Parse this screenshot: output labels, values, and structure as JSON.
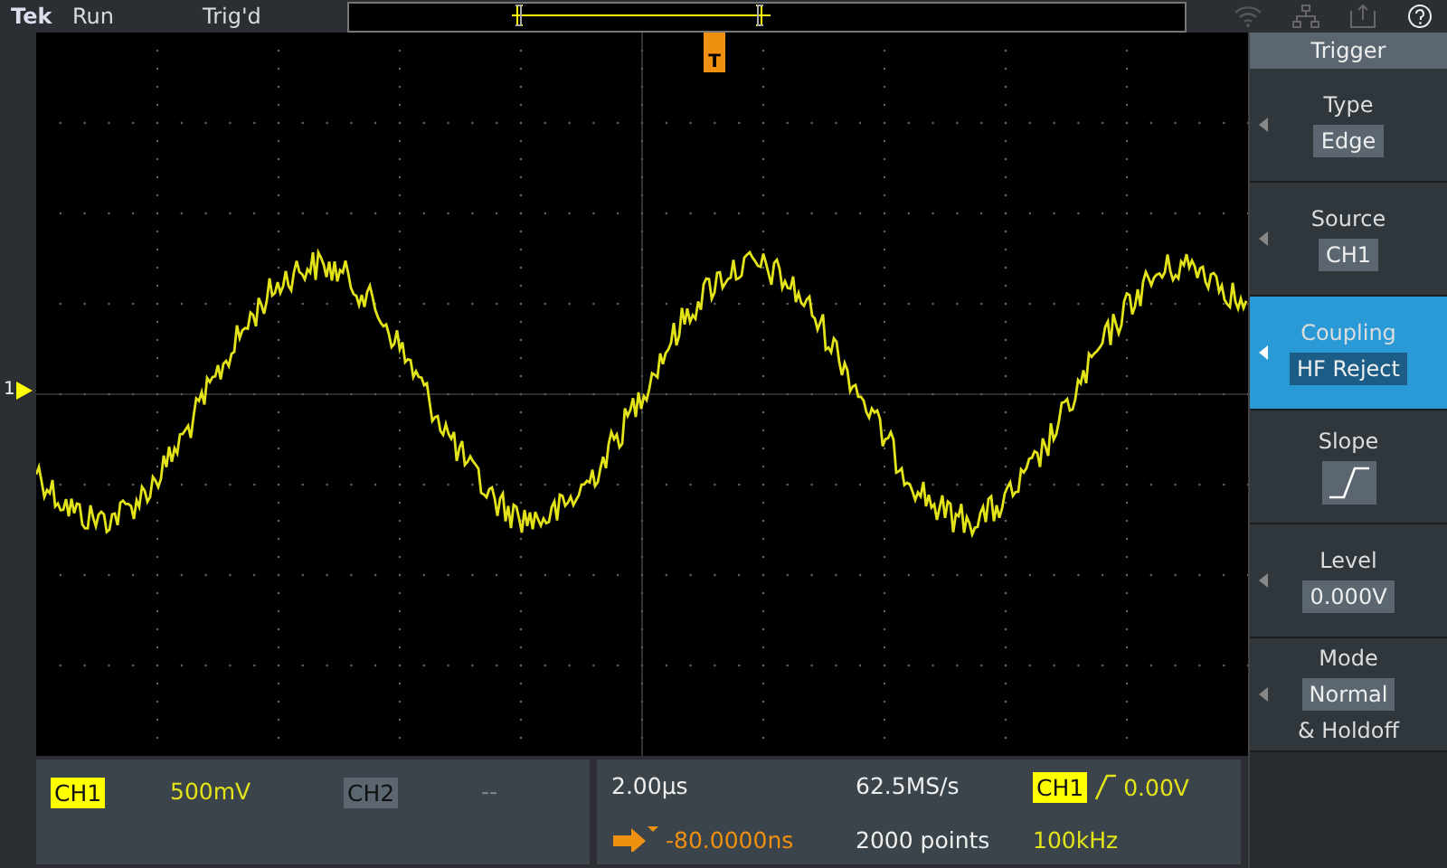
{
  "status_bar": {
    "brand": "Tek",
    "acquisition": "Run",
    "trigger_status": "Trig'd"
  },
  "waveform": {
    "channel_marker": "1",
    "trigger_marker": "T"
  },
  "trigger_menu": {
    "title": "Trigger",
    "items": [
      {
        "kind": "value",
        "label": "Type",
        "value": "Edge",
        "selected": false
      },
      {
        "kind": "value",
        "label": "Source",
        "value": "CH1",
        "selected": false
      },
      {
        "kind": "value",
        "label": "Coupling",
        "value": "HF Reject",
        "selected": true
      },
      {
        "kind": "slope",
        "label": "Slope",
        "selected": false
      },
      {
        "kind": "value",
        "label": "Level",
        "value": "0.000V",
        "selected": false
      },
      {
        "kind": "value",
        "label": "Mode",
        "value": "Normal",
        "note": "& Holdoff",
        "selected": false
      }
    ]
  },
  "channels": [
    {
      "label": "CH1",
      "scale": "500mV",
      "on": true
    },
    {
      "label": "CH2",
      "scale": "--",
      "on": false
    }
  ],
  "horizontal": {
    "scale": "2.00µs",
    "delay": "-80.0000ns",
    "sample_rate": "62.5MS/s",
    "record_length": "2000 points"
  },
  "trigger_readout": {
    "source": "CH1",
    "level": "0.00V",
    "frequency": "100kHz"
  }
}
